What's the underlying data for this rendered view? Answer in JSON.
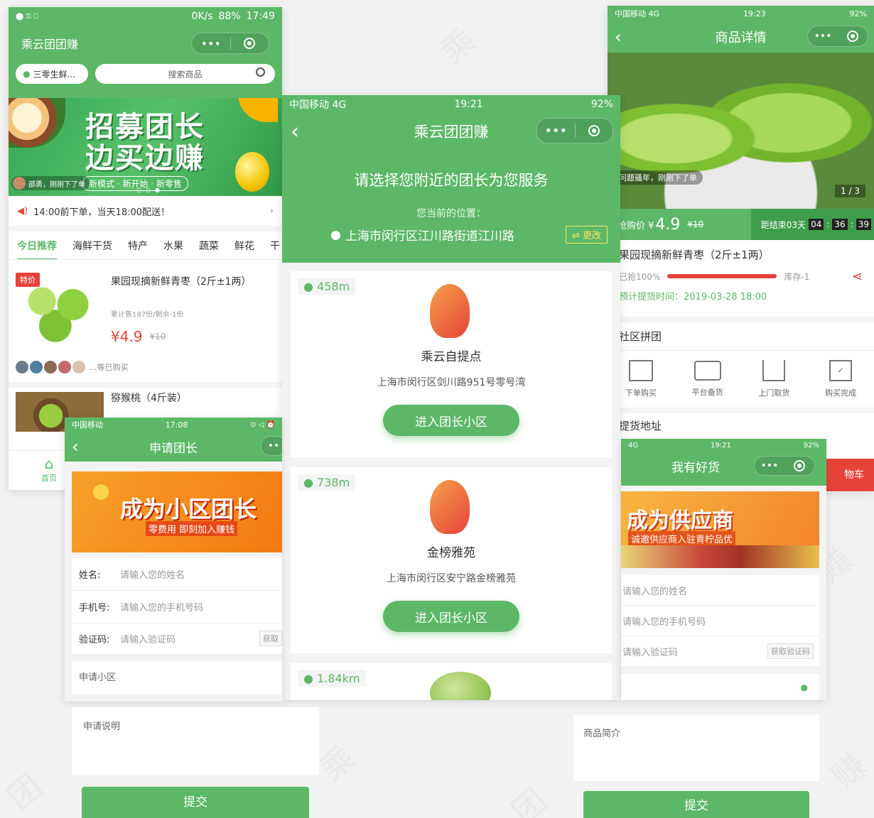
{
  "colors": {
    "brand": "#5cb867",
    "red": "#e5433a"
  },
  "p1": {
    "status": {
      "left": "⬤ ⚿ ⎕",
      "speed": "0K/s",
      "right": "88%",
      "time": "17:49"
    },
    "title": "乘云团团赚",
    "location": "三零生鲜...",
    "search_placeholder": "搜索商品",
    "banner": {
      "line1": "招募团长",
      "line2": "边买边赚",
      "sub": "新模式 · 新开始 · 新零售",
      "ticker": "邵勇，刚刚下了单"
    },
    "notice": "14:00前下单，当天18:00配送！",
    "tabs": [
      "今日推荐",
      "海鲜干货",
      "特产",
      "水果",
      "蔬菜",
      "鲜花",
      "干"
    ],
    "product": {
      "badge": "特价",
      "name": "果园现摘新鲜青枣（2斤±1两）",
      "sold": "累计售187份/剩余-1份",
      "price": "¥4.9",
      "orig": "¥10",
      "buyers": "...等已购买"
    },
    "product2_name": "猕猴桃（4斤装）",
    "nav_home": "首页"
  },
  "p2": {
    "status": {
      "carrier": "中国移动 4G",
      "time": "19:21",
      "battery": "92%"
    },
    "title": "乘云团团赚",
    "prompt": "请选择您附近的团长为您服务",
    "loc_label": "您当前的位置：",
    "loc_value": "上海市闵行区江川路街道江川路",
    "change": "更改",
    "leaders": [
      {
        "dist": "458m",
        "name": "乘云自提点",
        "addr": "上海市闵行区剑川路951号零号湾",
        "btn": "进入团长小区"
      },
      {
        "dist": "738m",
        "name": "金榜雅苑",
        "addr": "上海市闵行区安宁路金榜雅苑",
        "btn": "进入团长小区"
      },
      {
        "dist": "1.84km"
      }
    ]
  },
  "p3": {
    "status": {
      "carrier": "中国移动 4G",
      "time": "19:23",
      "battery": "92%"
    },
    "title": "商品详情",
    "ticker": "问题骚年，刚刚下了单",
    "pager": "1 / 3",
    "price_label": "抢购价 ¥",
    "price": "4.9",
    "orig": "¥10",
    "countdown_label": "距结束03天",
    "countdown": [
      "04",
      "36",
      "39"
    ],
    "name": "果园现摘新鲜青枣（2斤±1两）",
    "progress_label": "已抢100%",
    "progress": 1.0,
    "stock": "库存-1",
    "pickup_time": "预计提货时间：2019-03-28 18:00",
    "section_group": "社区拼团",
    "steps": [
      "下单购买",
      "平台备货",
      "上门取货",
      "购买完成"
    ],
    "section_addr": "提货地址",
    "cart": "物车"
  },
  "p4": {
    "status": {
      "carrier": "中国移动",
      "time": "17:08"
    },
    "title": "申请团长",
    "banner_title": "成为小区团长",
    "banner_sub": "零费用 即刻加入赚钱",
    "fields": [
      {
        "label": "姓名:",
        "placeholder": "请输入您的姓名"
      },
      {
        "label": "手机号:",
        "placeholder": "请输入您的手机号码"
      },
      {
        "label": "验证码:",
        "placeholder": "请输入验证码",
        "btn": "获取"
      }
    ],
    "apply_area": "申请小区",
    "apply_desc": "申请说明",
    "submit": "提交"
  },
  "p5": {
    "status": {
      "carrier": "4G",
      "time": "19:21",
      "battery": "92%"
    },
    "title": "我有好货",
    "banner_title": "成为供应商",
    "banner_sub": "诚邀供应商入驻青柠品优",
    "fields": [
      "请输入您的姓名",
      "请输入您的手机号码",
      "请输入验证码"
    ],
    "code_btn": "获取验证码",
    "intro": "商品简介",
    "submit": "提交"
  }
}
